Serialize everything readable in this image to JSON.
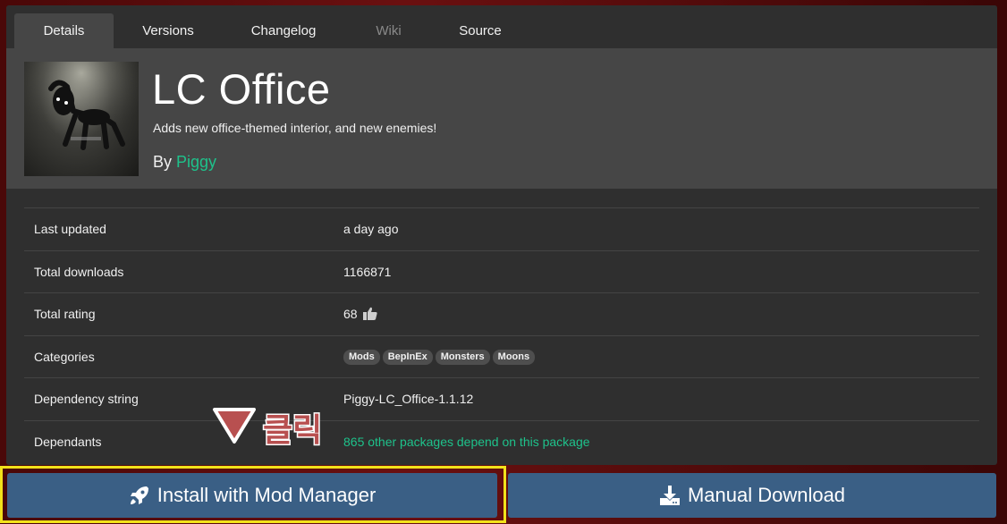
{
  "tabs": [
    {
      "label": "Details",
      "state": "active"
    },
    {
      "label": "Versions",
      "state": "normal"
    },
    {
      "label": "Changelog",
      "state": "normal"
    },
    {
      "label": "Wiki",
      "state": "disabled"
    },
    {
      "label": "Source",
      "state": "normal"
    }
  ],
  "package": {
    "name": "LC Office",
    "description": "Adds new office-themed interior, and new enemies!",
    "by_prefix": "By ",
    "author": "Piggy"
  },
  "details": {
    "last_updated": {
      "label": "Last updated",
      "value": "a day ago"
    },
    "total_downloads": {
      "label": "Total downloads",
      "value": "1166871"
    },
    "total_rating": {
      "label": "Total rating",
      "value": "68"
    },
    "categories": {
      "label": "Categories",
      "items": [
        "Mods",
        "BepInEx",
        "Monsters",
        "Moons"
      ]
    },
    "dependency_string": {
      "label": "Dependency string",
      "value": "Piggy-LC_Office-1.1.12"
    },
    "dependants": {
      "label": "Dependants",
      "value": "865 other packages depend on this package"
    }
  },
  "buttons": {
    "install": "Install with Mod Manager",
    "download": "Manual Download"
  },
  "annotation": {
    "text": "클릭"
  },
  "colors": {
    "accent_green": "#1ec28b",
    "button_blue": "#3a5f85",
    "highlight_yellow": "#f2e21a"
  }
}
